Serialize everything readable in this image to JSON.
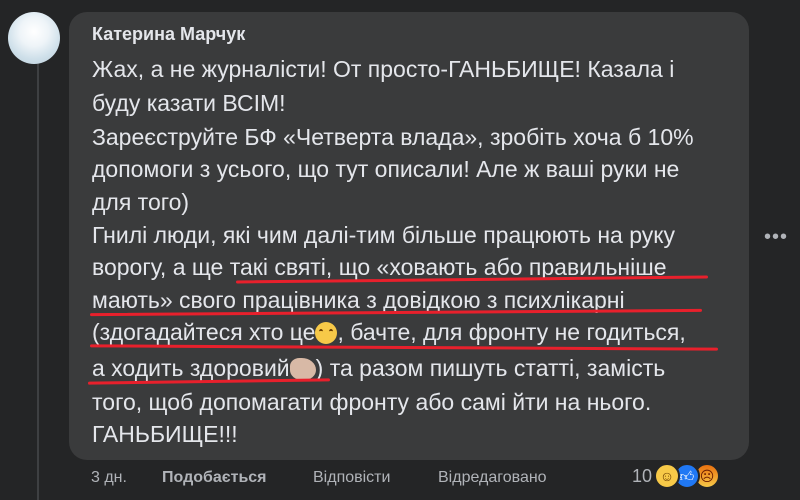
{
  "comment": {
    "author": "Катерина Марчук",
    "lines": [
      "Жах, а не журналісти! От просто-ГАНЬБИЩЕ! Казала і",
      "буду казати ВСІМ!",
      "Зареєструйте БФ «Четверта влада», зробіть хоча б 10%",
      "допомоги з усього, що тут описали! Але ж ваші руки не",
      "для того)",
      "Гнилі люди, які чим далі-тим більше працюють на руку",
      "ворогу, а ще такі святі, що «ховають або правильніше",
      "мають» свого працівника з довідкою з психлікарні",
      "(здогадайтеся хто це",
      ", бачте, для фронту не годиться,",
      "а ходить здоровий",
      ") та разом пишуть статті, замість",
      "того, щоб допомагати фронту або самі йти на нього.",
      "ГАНЬБИЩЕ!!!"
    ]
  },
  "footer": {
    "time": "3 дн.",
    "like": "Подобається",
    "reply": "Відповісти",
    "edited": "Відредаговано",
    "reaction_count": "10"
  },
  "icons": {
    "more": "more-options-icon",
    "reactions": [
      "haha-reaction-icon",
      "like-reaction-icon",
      "angry-reaction-icon"
    ],
    "inline": [
      "smiling-face-emoji-icon",
      "flexed-biceps-emoji-icon"
    ]
  },
  "colors": {
    "background": "#242526",
    "bubble": "#3a3b3c",
    "text": "#e4e6eb",
    "secondary_text": "#b0b3b8",
    "underline": "#e8202c",
    "like_blue": "#2078f4"
  }
}
